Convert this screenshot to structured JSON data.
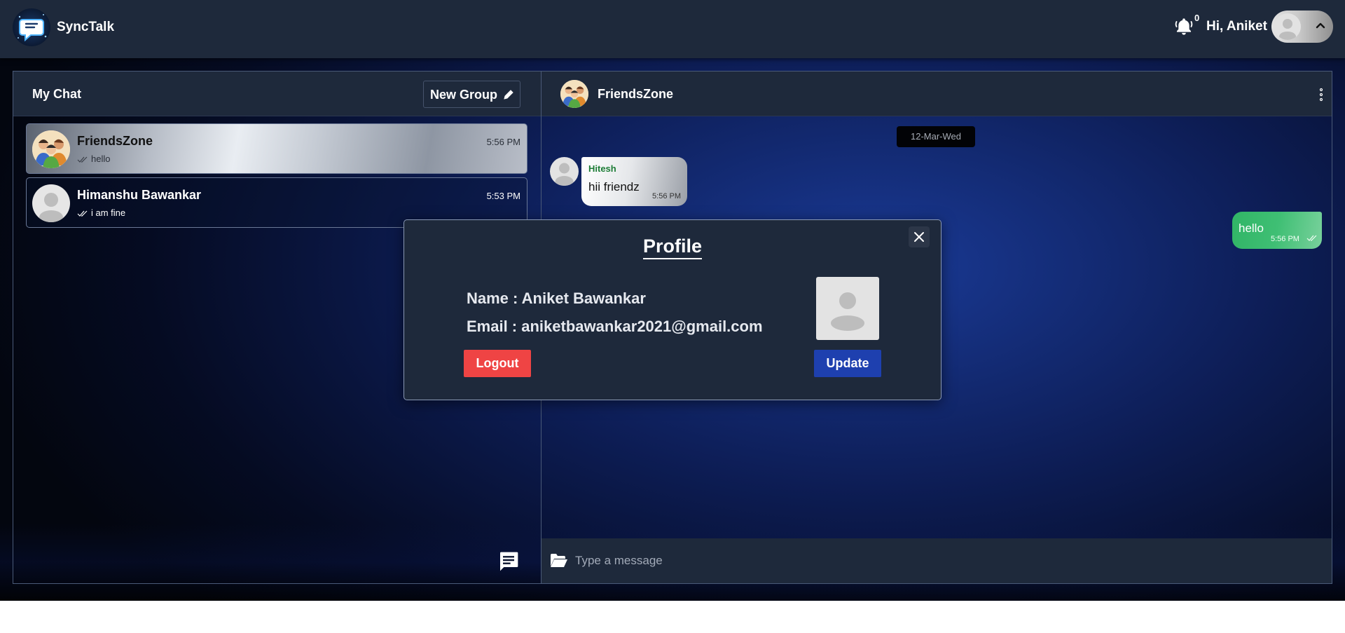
{
  "app": {
    "name": "SyncTalk",
    "logo_icon": "chat-bubble-logo-icon"
  },
  "header": {
    "notification_count": "0",
    "greeting": "Hi, Aniket"
  },
  "sidebar": {
    "title": "My Chat",
    "new_group_label": "New Group",
    "chats": [
      {
        "name": "FriendsZone",
        "time": "5:56 PM",
        "last_message": "hello",
        "active": true
      },
      {
        "name": "Himanshu Bawankar",
        "time": "5:53 PM",
        "last_message": "i am fine",
        "active": false
      }
    ]
  },
  "conversation": {
    "title": "FriendsZone",
    "date_separator": "12-Mar-Wed",
    "messages": [
      {
        "direction": "incoming",
        "sender": "Hitesh",
        "text": "hii friendz",
        "time": "5:56 PM"
      },
      {
        "direction": "outgoing",
        "text": "hello",
        "time": "5:56 PM"
      }
    ],
    "input_placeholder": "Type a message"
  },
  "profile_modal": {
    "title": "Profile",
    "name_line": "Name : Aniket Bawankar",
    "email_line": "Email : aniketbawankar2021@gmail.com",
    "logout_label": "Logout",
    "update_label": "Update"
  },
  "colors": {
    "header_bg": "#1e293b",
    "logout": "#ef4444",
    "update": "#1e40af",
    "outgoing_bubble": "#3fbf74",
    "sender_name": "#1c7c35"
  }
}
